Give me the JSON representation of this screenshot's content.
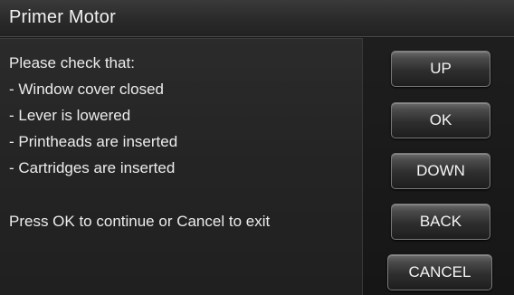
{
  "window": {
    "title": "Primer Motor"
  },
  "message": {
    "lines": [
      "Please check that:",
      " - Window cover closed",
      " - Lever is lowered",
      " - Printheads are inserted",
      " - Cartridges are inserted",
      "",
      "Press OK to continue or Cancel to exit"
    ]
  },
  "buttons": {
    "up": "UP",
    "ok": "OK",
    "down": "DOWN",
    "back": "BACK",
    "cancel": "CANCEL"
  },
  "colors": {
    "background": "#1a1a1a",
    "text": "#ececec",
    "button_border": "#7a7a7a"
  }
}
